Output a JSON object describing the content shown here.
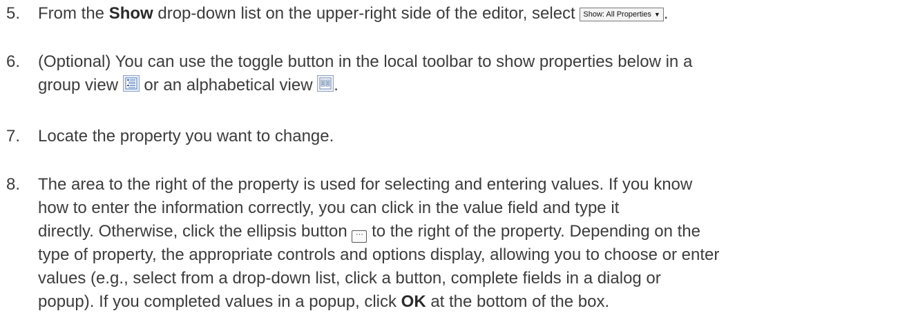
{
  "steps": [
    {
      "number": "5.",
      "text_before": "From the ",
      "bold": "Show",
      "text_middle": " drop-down list on the upper-right side of the editor, select ",
      "control_label": "Show: All Properties",
      "text_after": "."
    },
    {
      "number": "6.",
      "line1": "(Optional) You can use the toggle button in the local toolbar to show properties below in a",
      "line2_before": "group view ",
      "line2_middle": " or an alphabetical view ",
      "line2_after": ".",
      "icons": [
        "group-view-icon",
        "alphabetical-view-icon"
      ]
    },
    {
      "number": "7.",
      "text": "Locate the property you want to change."
    },
    {
      "number": "8.",
      "line1": "The area to the right of the property is used for selecting and entering values. If you know",
      "line2": "how to enter the information correctly, you can click in the value field and type it",
      "line3_before": "directly. Otherwise, click the ellipsis button ",
      "line3_after": " to the right of the property. Depending on the",
      "line4": "type of property, the appropriate controls and options display, allowing you to choose or enter",
      "line5": "values (e.g., select from a drop-down list, click a button, complete fields in a dialog or",
      "line6_before": "popup). If you completed values in a popup, click ",
      "line6_bold": "OK",
      "line6_after": " at the bottom of the box.",
      "ellipsis_glyph": "···"
    }
  ]
}
